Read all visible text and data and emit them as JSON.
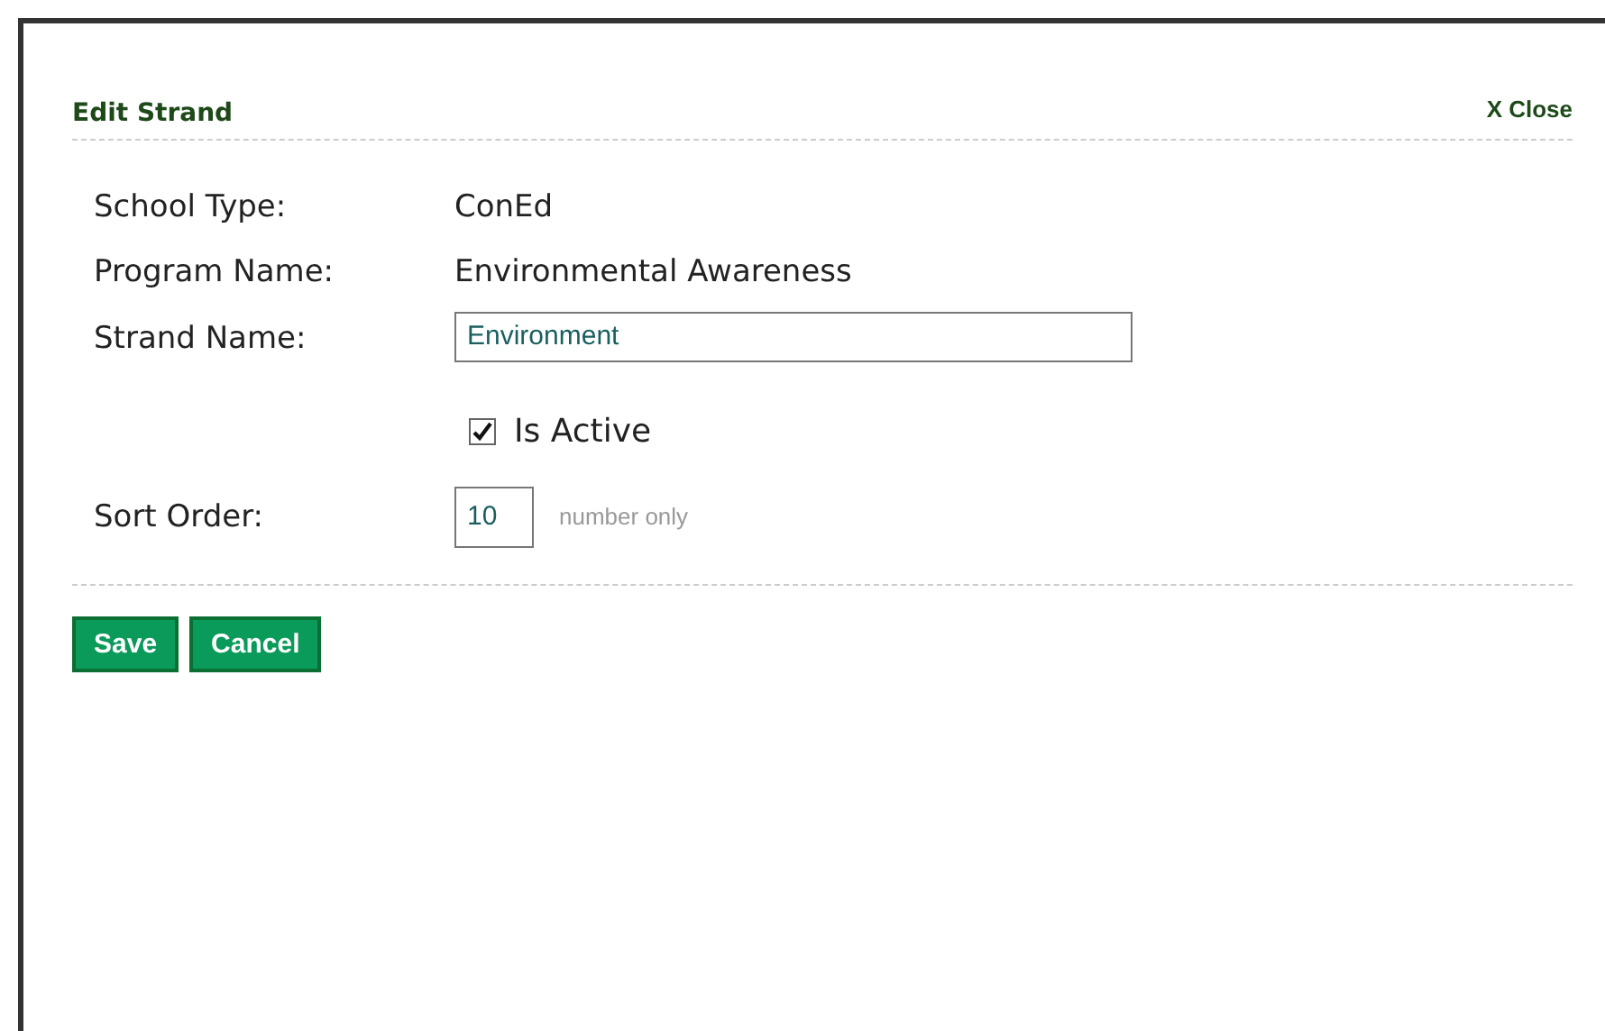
{
  "dialog": {
    "title": "Edit Strand",
    "close": "X Close"
  },
  "fields": [
    {
      "kind": "text",
      "label": "School Type:",
      "value": "ConEd"
    },
    {
      "kind": "text",
      "label": "Program Name:",
      "value": "Environmental Awareness"
    },
    {
      "kind": "input",
      "label": "Strand Name:",
      "value": "Environment"
    },
    {
      "kind": "checkbox",
      "label": "Is Active",
      "checked": true
    },
    {
      "kind": "number",
      "label": "Sort Order:",
      "value": "10",
      "hint": "number only"
    }
  ],
  "buttons": [
    "Save",
    "Cancel"
  ]
}
